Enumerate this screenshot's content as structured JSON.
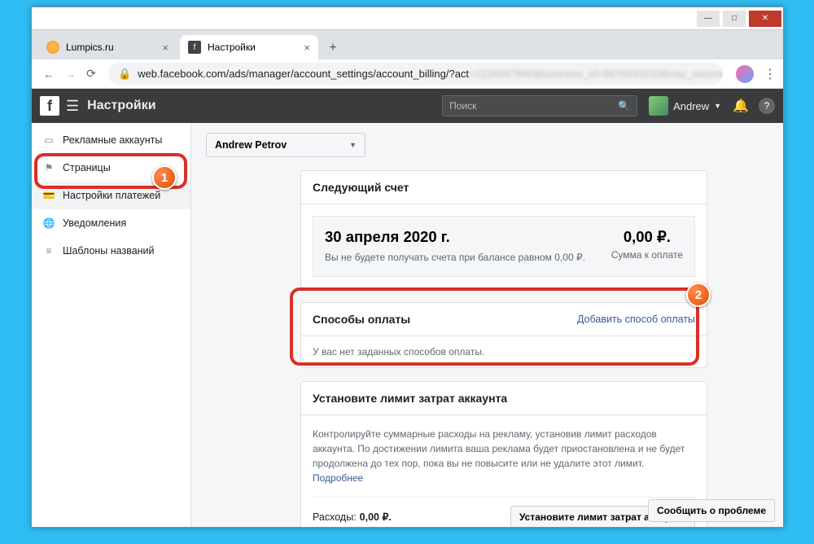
{
  "browser": {
    "tabs": [
      {
        "title": "Lumpics.ru"
      },
      {
        "title": "Настройки"
      }
    ],
    "url_visible": "web.facebook.com/ads/manager/account_settings/account_billing/?act"
  },
  "header": {
    "title": "Настройки",
    "search_placeholder": "Поиск",
    "user_name": "Andrew"
  },
  "sidebar": {
    "items": [
      {
        "label": "Рекламные аккаунты"
      },
      {
        "label": "Страницы"
      },
      {
        "label": "Настройки платежей"
      },
      {
        "label": "Уведомления"
      },
      {
        "label": "Шаблоны названий"
      }
    ]
  },
  "account_dropdown": "Andrew Petrov",
  "next_bill": {
    "title": "Следующий счет",
    "date": "30 апреля 2020 г.",
    "note": "Вы не будете получать счета при балансе равном 0,00 ₽.",
    "amount": "0,00 ₽.",
    "amount_label": "Сумма к оплате"
  },
  "payment_methods": {
    "title": "Способы оплаты",
    "add_link": "Добавить способ оплаты",
    "empty_text": "У вас нет заданных способов оплаты."
  },
  "spend_limit": {
    "title": "Установите лимит затрат аккаунта",
    "desc": "Контролируйте суммарные расходы на рекламу, установив лимит расходов аккаунта. По достижении лимита ваша реклама будет приостановлена и не будет продолжена до тех пор, пока вы не повысите или не удалите этот лимит.",
    "more": "Подробнее",
    "spend_label": "Расходы:",
    "spend_value": "0,00 ₽.",
    "button": "Установите лимит затрат аккаунта"
  },
  "report_button": "Сообщить о проблеме",
  "annotations": {
    "b1": "1",
    "b2": "2"
  }
}
